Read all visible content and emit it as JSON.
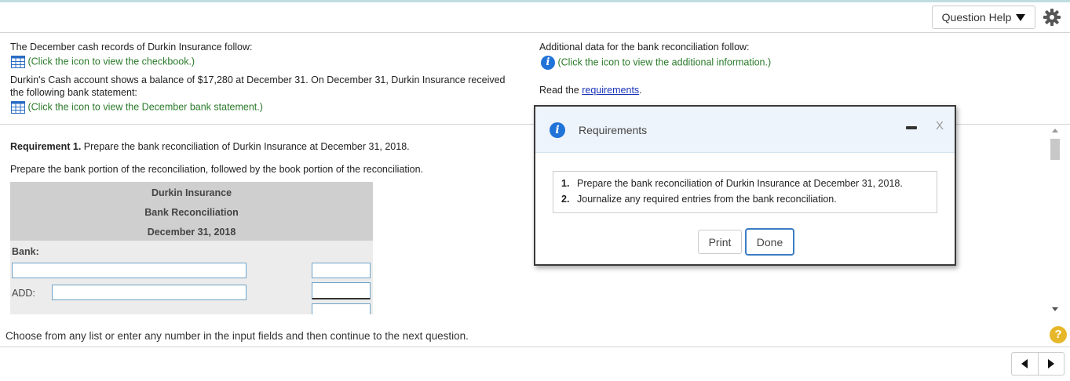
{
  "toolbar": {
    "question_help_label": "Question Help"
  },
  "left": {
    "intro": "The December cash records of Durkin Insurance follow:",
    "checkbook_link": "(Click the icon to view the checkbook.)",
    "balance_line1": "Durkin's Cash account shows a balance of $17,280 at December 31. On December 31, Durkin Insurance received",
    "balance_line2": "the following bank statement:",
    "statement_link": "(Click the icon to view the December bank statement.)"
  },
  "right": {
    "additional_intro": "Additional data for the bank reconciliation follow:",
    "additional_link": "(Click the icon to view the additional information.)",
    "read_the": "Read the",
    "requirements_link": "requirements",
    "period": "."
  },
  "main": {
    "req1_bold": "Requirement 1.",
    "req1_text": "Prepare the bank reconciliation of Durkin Insurance at December 31, 2018.",
    "instruction": "Prepare the bank portion of the reconciliation, followed by the book portion of the reconciliation.",
    "recon": {
      "company": "Durkin Insurance",
      "title": "Bank Reconciliation",
      "date": "December 31, 2018",
      "bank_label": "Bank:",
      "add_label": "ADD:"
    }
  },
  "modal": {
    "title": "Requirements",
    "close_label": "X",
    "items": [
      {
        "num": "1.",
        "text": "Prepare the bank reconciliation of Durkin Insurance at December 31, 2018."
      },
      {
        "num": "2.",
        "text": "Journalize any required entries from the bank reconciliation."
      }
    ],
    "print_label": "Print",
    "done_label": "Done"
  },
  "footer": {
    "instruction": "Choose from any list or enter any number in the input fields and then continue to the next question.",
    "help_glyph": "?"
  },
  "colors": {
    "link_green": "#2a7a2a",
    "info_blue": "#2173d8",
    "input_border": "#6fa3c8",
    "help_yellow": "#e7b72a"
  }
}
